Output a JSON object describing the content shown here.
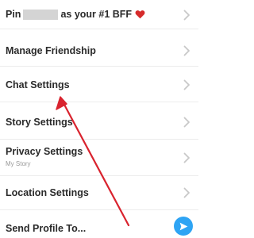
{
  "menu": {
    "pin": {
      "prefix": "Pin",
      "suffix": "as your #1 BFF",
      "heart_icon": "heart-icon",
      "heart_color": "#d62b2b"
    },
    "manage_friendship": "Manage Friendship",
    "chat_settings": "Chat Settings",
    "story_settings": "Story Settings",
    "privacy_settings": {
      "label": "Privacy Settings",
      "sublabel": "My Story"
    },
    "location_settings": "Location Settings",
    "send_profile": "Send Profile To..."
  },
  "icons": {
    "chevron": "chevron-right-icon",
    "send": "send-arrow-icon",
    "annotation": "red-arrow-annotation"
  },
  "colors": {
    "accent_blue": "#2ea4f4",
    "annotation_red": "#d9232e",
    "chevron_gray": "#c8c8c8"
  }
}
